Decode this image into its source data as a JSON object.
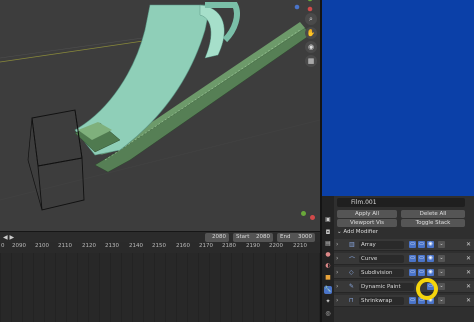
{
  "colors": {
    "render_bg": "#0b40a8",
    "accent_blue": "#4a74c9",
    "highlight": "#f4d40c",
    "film_color": "#8fcfb8"
  },
  "viewport": {
    "nav_icons": [
      "zoom-icon",
      "hand-icon",
      "camera-icon",
      "grid-icon"
    ]
  },
  "timeline": {
    "current_frame": "2080",
    "start_label": "Start",
    "start_value": "2080",
    "end_label": "End",
    "end_value": "3000",
    "ruler_ticks": [
      "2090",
      "2100",
      "2110",
      "2120",
      "2130",
      "2140",
      "2150",
      "2160",
      "2170",
      "2180",
      "2190",
      "2200",
      "2210"
    ],
    "ruler_first": "0"
  },
  "properties": {
    "object_name": "Film.001",
    "apply_all": "Apply All",
    "delete_all": "Delete All",
    "viewport_vis": "Viewport Vis",
    "toggle_stack": "Toggle Stack",
    "add_modifier": "Add Modifier",
    "modifiers": [
      {
        "name": "Array",
        "icon": "array-icon"
      },
      {
        "name": "Curve",
        "icon": "curve-icon"
      },
      {
        "name": "Subdivision",
        "icon": "subdivision-icon"
      },
      {
        "name": "Dynamic Paint",
        "icon": "brush-icon"
      },
      {
        "name": "Shrinkwrap",
        "icon": "shrinkwrap-icon"
      }
    ]
  }
}
